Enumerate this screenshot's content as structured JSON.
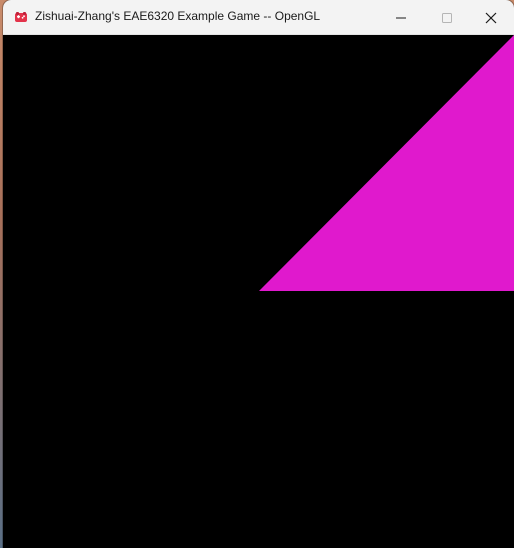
{
  "window": {
    "title": "Zishuai-Zhang's EAE6320 Example Game -- OpenGL",
    "app_icon": "game-controller-icon",
    "controls": {
      "minimize_icon": "minimize-icon",
      "maximize_icon": "maximize-icon",
      "close_icon": "close-icon"
    }
  },
  "viewport": {
    "background_color": "#000000",
    "shape": {
      "kind": "triangle",
      "color": "#e019cd"
    }
  }
}
